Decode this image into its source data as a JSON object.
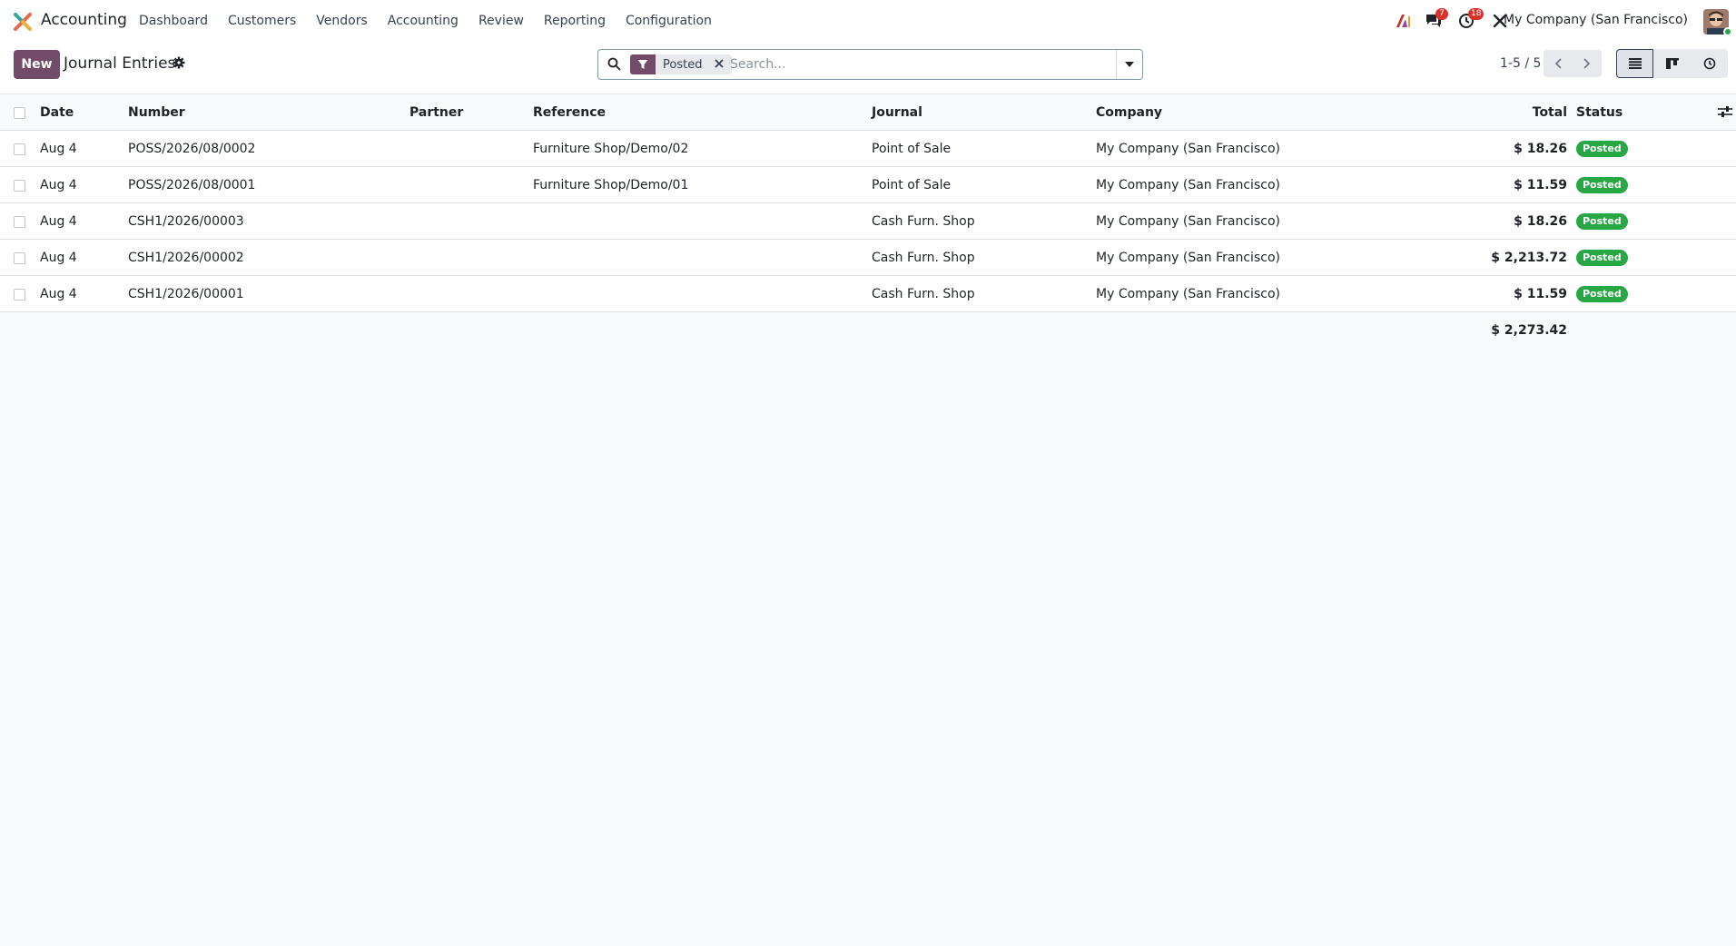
{
  "navbar": {
    "app_name": "Accounting",
    "menu": [
      "Dashboard",
      "Customers",
      "Vendors",
      "Accounting",
      "Review",
      "Reporting",
      "Configuration"
    ],
    "messages_count": "7",
    "activities_count": "18",
    "company": "My Company (San Francisco)"
  },
  "control": {
    "new_label": "New",
    "title": "Journal Entries",
    "filter_facet": "Posted",
    "search_placeholder": "Search...",
    "pager": "1-5 / 5"
  },
  "table": {
    "headers": {
      "date": "Date",
      "number": "Number",
      "partner": "Partner",
      "reference": "Reference",
      "journal": "Journal",
      "company": "Company",
      "total": "Total",
      "status": "Status"
    },
    "rows": [
      {
        "date": "Aug 4",
        "number": "POSS/2026/08/0002",
        "partner": "",
        "reference": "Furniture Shop/Demo/02",
        "journal": "Point of Sale",
        "company": "My Company (San Francisco)",
        "total": "$ 18.26",
        "status": "Posted"
      },
      {
        "date": "Aug 4",
        "number": "POSS/2026/08/0001",
        "partner": "",
        "reference": "Furniture Shop/Demo/01",
        "journal": "Point of Sale",
        "company": "My Company (San Francisco)",
        "total": "$ 11.59",
        "status": "Posted"
      },
      {
        "date": "Aug 4",
        "number": "CSH1/2026/00003",
        "partner": "",
        "reference": "",
        "journal": "Cash Furn. Shop",
        "company": "My Company (San Francisco)",
        "total": "$ 18.26",
        "status": "Posted"
      },
      {
        "date": "Aug 4",
        "number": "CSH1/2026/00002",
        "partner": "",
        "reference": "",
        "journal": "Cash Furn. Shop",
        "company": "My Company (San Francisco)",
        "total": "$ 2,213.72",
        "status": "Posted"
      },
      {
        "date": "Aug 4",
        "number": "CSH1/2026/00001",
        "partner": "",
        "reference": "",
        "journal": "Cash Furn. Shop",
        "company": "My Company (San Francisco)",
        "total": "$ 11.59",
        "status": "Posted"
      }
    ],
    "grand_total": "$ 2,273.42"
  },
  "colors": {
    "brand": "#714b67",
    "posted": "#28a745",
    "badge": "#d9342b"
  }
}
